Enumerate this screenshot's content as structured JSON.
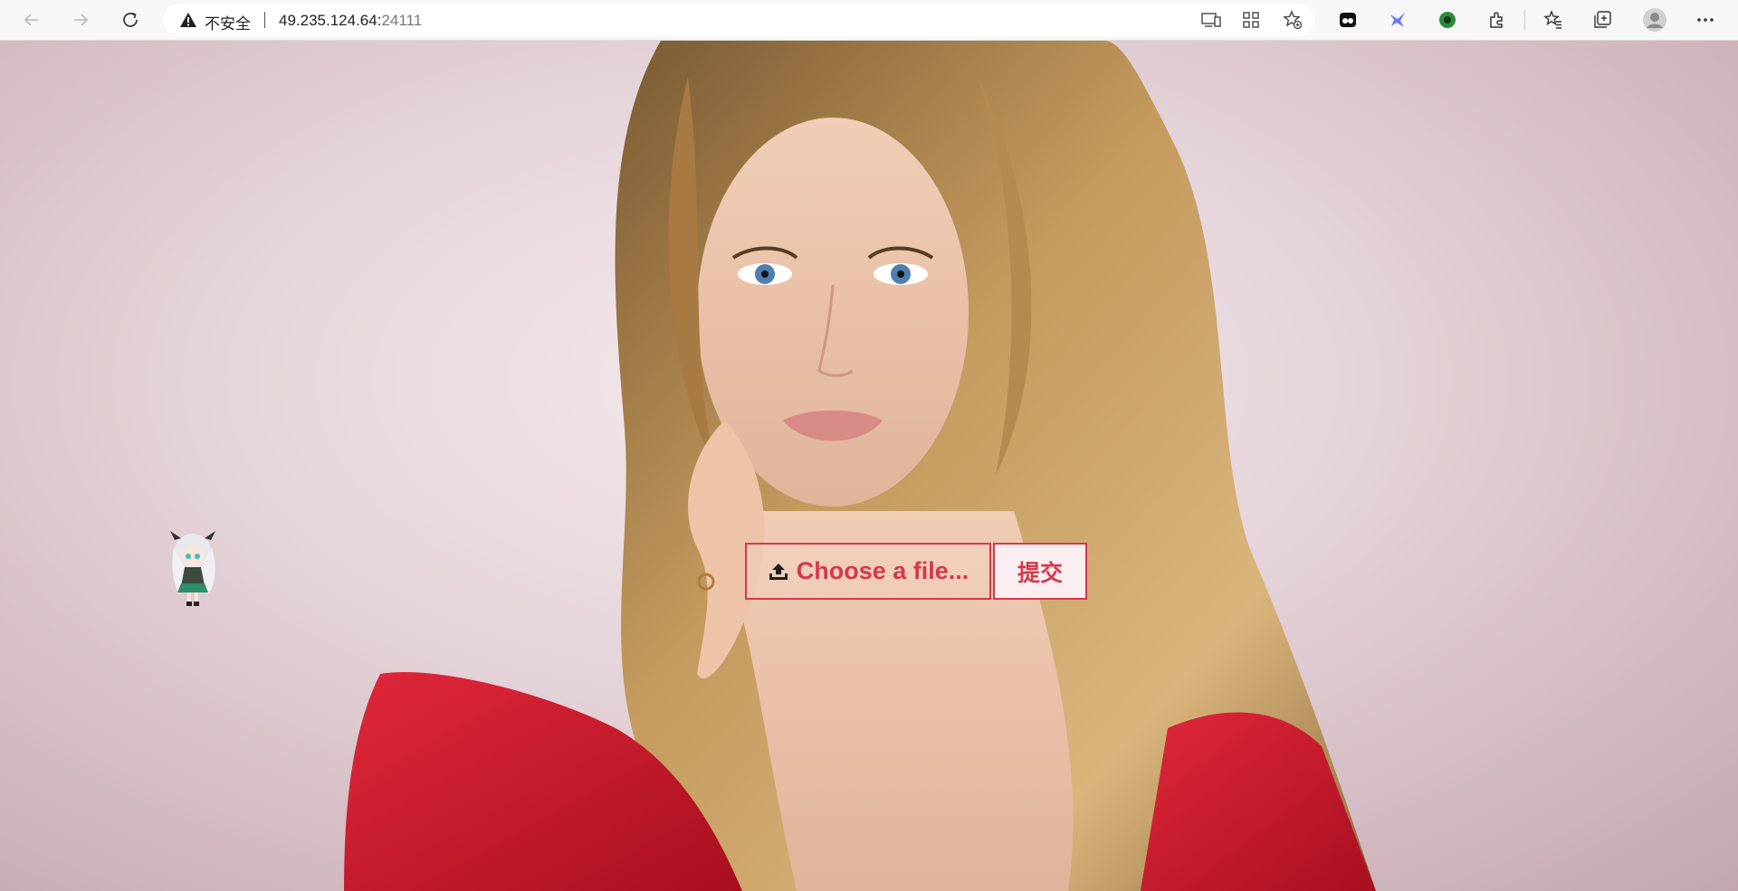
{
  "browser": {
    "security_label": "不安全",
    "url_host": "49.235.124.64:",
    "url_port": "24111",
    "icons": [
      "back-icon",
      "forward-icon",
      "refresh-icon",
      "warning-icon",
      "read-aloud-icon",
      "app-grid-icon",
      "add-favorite-icon",
      "extension-1-icon",
      "extension-2-icon",
      "extension-3-icon",
      "extensions-icon",
      "favorites-icon",
      "collections-icon",
      "profile-icon",
      "more-icon"
    ]
  },
  "upload": {
    "choose_label": "Choose a file...",
    "submit_label": "提交",
    "icon": "upload-icon"
  },
  "colors": {
    "accent": "#d3394c",
    "dress": "#c8162a",
    "hair": "#b98a4e",
    "background": "#e6d6db"
  }
}
